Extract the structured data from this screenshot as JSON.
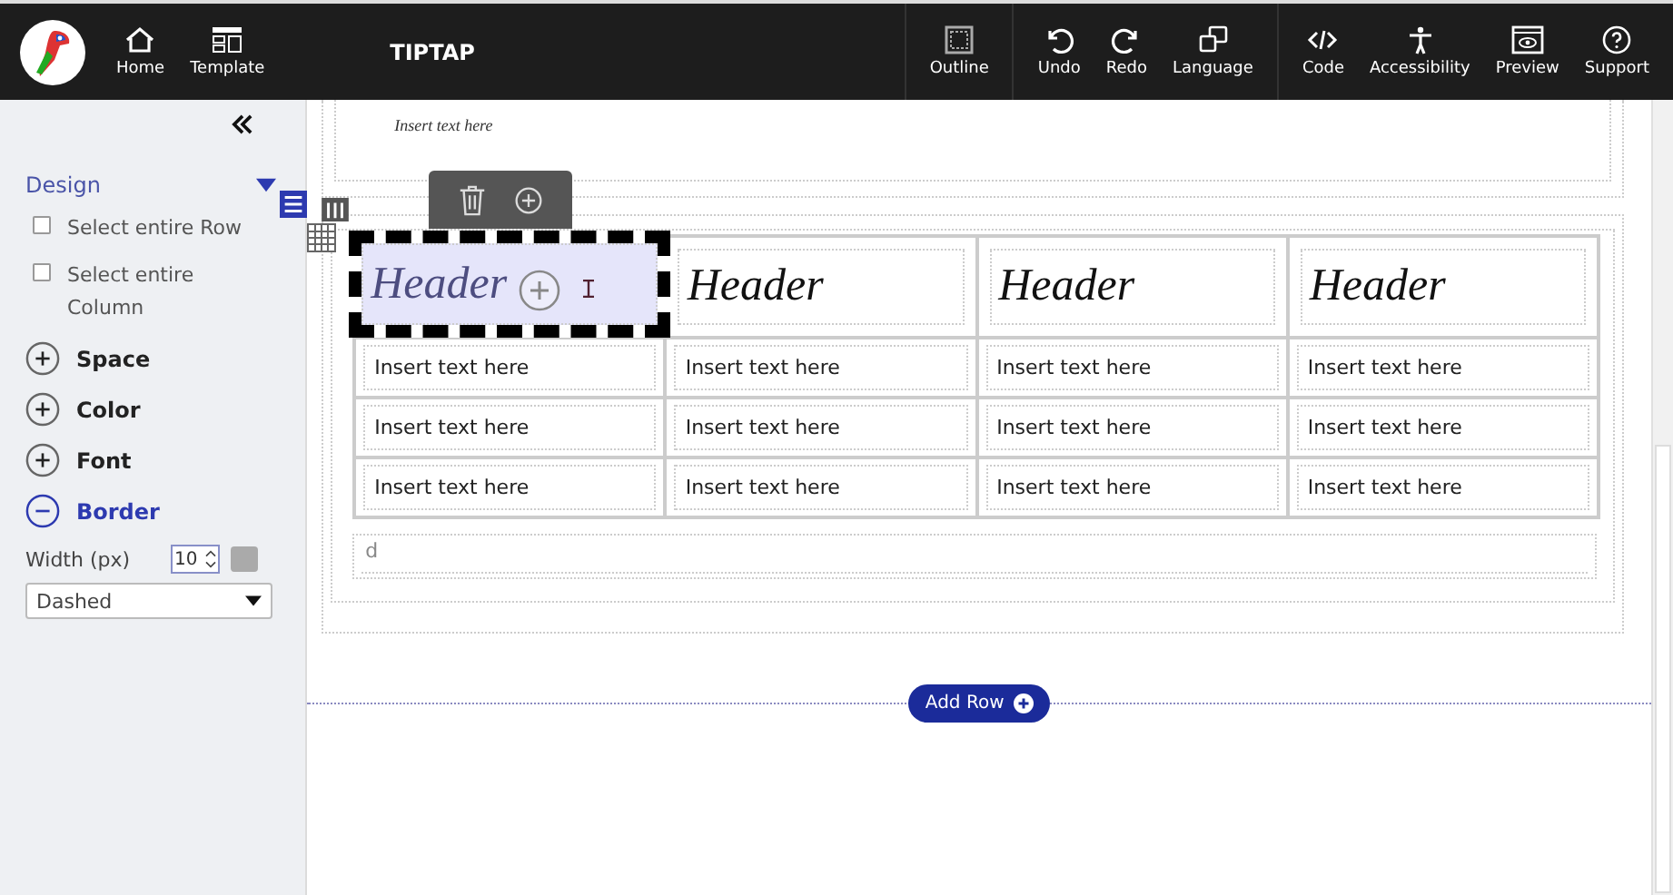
{
  "toolbar": {
    "left": [
      {
        "kind": "home",
        "label": "Home"
      },
      {
        "kind": "template",
        "label": "Template"
      }
    ],
    "title": "TIPTAP",
    "groups": [
      [
        {
          "kind": "outline",
          "label": "Outline"
        }
      ],
      [
        {
          "kind": "undo",
          "label": "Undo"
        },
        {
          "kind": "redo",
          "label": "Redo"
        },
        {
          "kind": "language",
          "label": "Language"
        }
      ],
      [
        {
          "kind": "code",
          "label": "Code"
        },
        {
          "kind": "accessibility",
          "label": "Accessibility"
        },
        {
          "kind": "preview",
          "label": "Preview"
        },
        {
          "kind": "support",
          "label": "Support"
        }
      ]
    ]
  },
  "sidebar": {
    "design": {
      "label": "Design",
      "expanded": true
    },
    "checkboxes": [
      {
        "label": "Select entire Row",
        "checked": false
      },
      {
        "label": "Select entire Column",
        "checked": false
      }
    ],
    "sections": [
      {
        "label": "Space",
        "expanded": false
      },
      {
        "label": "Color",
        "expanded": false
      },
      {
        "label": "Font",
        "expanded": false
      },
      {
        "label": "Border",
        "expanded": true
      }
    ],
    "border": {
      "width_label": "Width (px)",
      "width_value": "10",
      "style": "Dashed"
    }
  },
  "canvas": {
    "top_text": "Insert text here",
    "table": {
      "headers": [
        {
          "text": "Header",
          "selected": true
        },
        {
          "text": "Header",
          "selected": false
        },
        {
          "text": "Header",
          "selected": false
        },
        {
          "text": "Header",
          "selected": false
        }
      ],
      "rows": [
        [
          "Insert text here",
          "Insert text here",
          "Insert text here",
          "Insert text here"
        ],
        [
          "Insert text here",
          "Insert text here",
          "Insert text here",
          "Insert text here"
        ],
        [
          "Insert text here",
          "Insert text here",
          "Insert text here",
          "Insert text here"
        ]
      ]
    },
    "footer_text": "d",
    "add_row": "Add Row"
  }
}
